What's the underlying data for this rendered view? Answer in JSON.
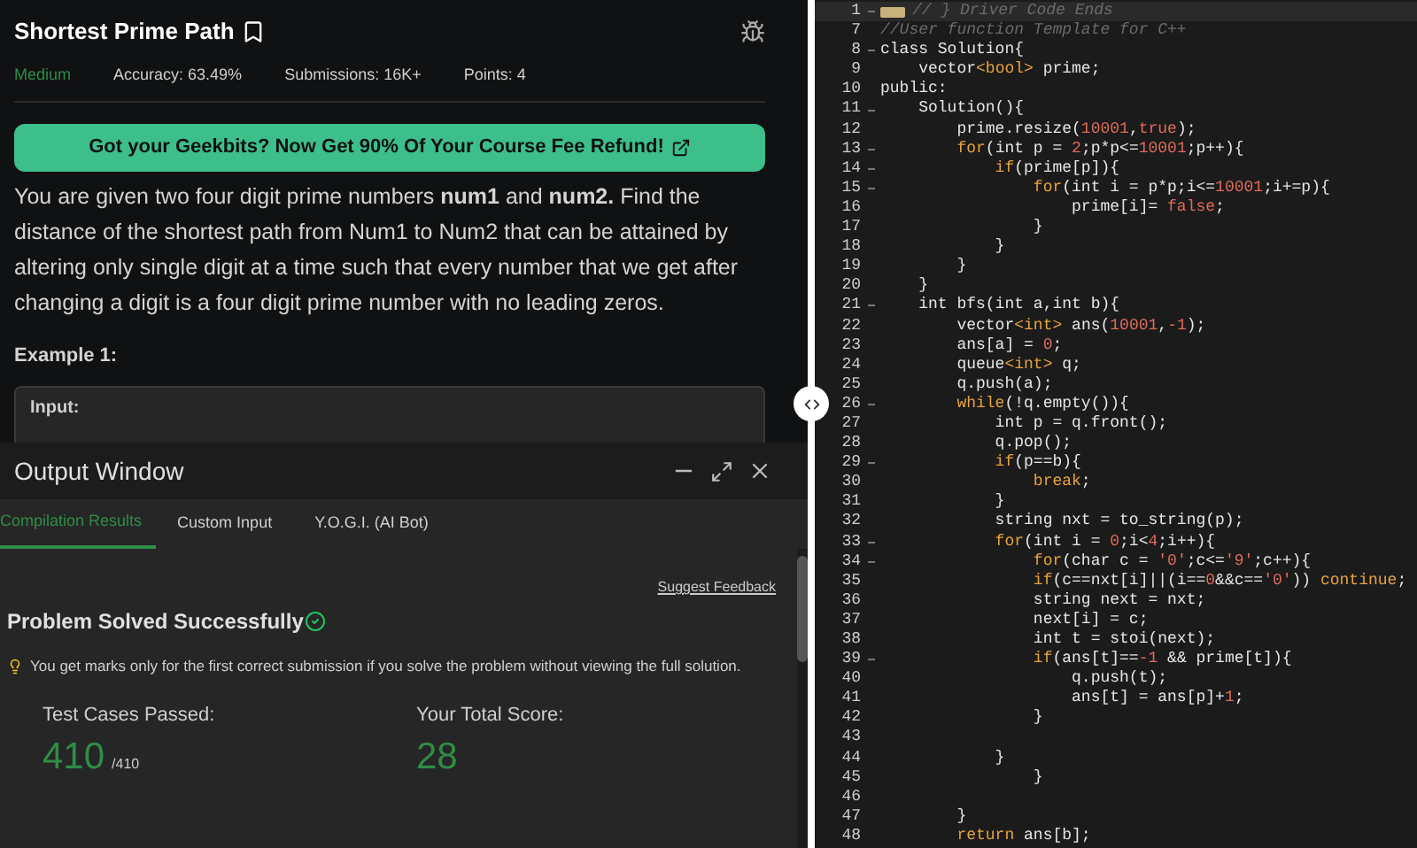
{
  "problem": {
    "title": "Shortest Prime Path",
    "difficulty": "Medium",
    "stats": [
      "Accuracy: 63.49%",
      "Submissions: 16K+",
      "Points: 4"
    ],
    "banner": "Got your Geekbits? Now Get 90% Of Your Course Fee Refund!",
    "description": "You are given two four digit prime numbers **num1** and **num2.** Find the distance of the shortest path from Num1 to Num2 that can be attained by altering only single digit at a time such that every number that we get after changing a digit is a four digit prime number with no leading zeros.",
    "example_heading": "Example 1:",
    "example_input": "Input:"
  },
  "output_window": {
    "title": "Output Window",
    "tabs": [
      {
        "label": "Compilation Results",
        "selected": true
      },
      {
        "label": "Custom Input",
        "selected": false
      },
      {
        "label": "Y.O.G.I. (AI Bot)",
        "selected": false
      }
    ],
    "feedback_link": "Suggest Feedback",
    "status": "Problem Solved Successfully",
    "note": "You get marks only for the first correct submission if you solve the problem without viewing the full solution.",
    "stats": [
      {
        "label": "Test Cases Passed:",
        "value": "410",
        "total": "/410"
      },
      {
        "label": "Your Total Score:",
        "value": "28"
      }
    ]
  },
  "editor": {
    "lines": [
      {
        "num": "1",
        "fold": true,
        "folded": true,
        "tokens": [
          {
            "kind": "comment",
            "text": "// } Driver Code Ends"
          }
        ]
      },
      {
        "num": "7",
        "fold": false,
        "folded": false,
        "tokens": [
          {
            "kind": "comment",
            "text": "//User function Template for C++"
          }
        ]
      },
      {
        "num": "8",
        "fold": true,
        "folded": false,
        "tokens": [
          {
            "kind": "plain",
            "text": "class Solution{"
          }
        ]
      },
      {
        "num": "9",
        "fold": false,
        "folded": false,
        "tokens": [
          {
            "kind": "plain",
            "text": "    vector"
          },
          {
            "kind": "type",
            "text": "<bool>"
          },
          {
            "kind": "plain",
            "text": " prime;"
          }
        ]
      },
      {
        "num": "10",
        "fold": false,
        "folded": false,
        "tokens": [
          {
            "kind": "plain",
            "text": "public:"
          }
        ]
      },
      {
        "num": "11",
        "fold": true,
        "folded": false,
        "tokens": [
          {
            "kind": "plain",
            "text": "    Solution(){"
          }
        ]
      },
      {
        "num": "12",
        "fold": false,
        "folded": false,
        "tokens": [
          {
            "kind": "plain",
            "text": "        prime.resize("
          },
          {
            "kind": "num",
            "text": "10001"
          },
          {
            "kind": "plain",
            "text": ","
          },
          {
            "kind": "num",
            "text": "true"
          },
          {
            "kind": "plain",
            "text": ");"
          }
        ]
      },
      {
        "num": "13",
        "fold": true,
        "folded": false,
        "tokens": [
          {
            "kind": "kw",
            "text": "        for"
          },
          {
            "kind": "plain",
            "text": "(int p = "
          },
          {
            "kind": "num",
            "text": "2"
          },
          {
            "kind": "plain",
            "text": ";p*p<="
          },
          {
            "kind": "num",
            "text": "10001"
          },
          {
            "kind": "plain",
            "text": ";p++){"
          }
        ]
      },
      {
        "num": "14",
        "fold": true,
        "folded": false,
        "tokens": [
          {
            "kind": "kw",
            "text": "            if"
          },
          {
            "kind": "plain",
            "text": "(prime[p]){"
          }
        ]
      },
      {
        "num": "15",
        "fold": true,
        "folded": false,
        "tokens": [
          {
            "kind": "kw",
            "text": "                for"
          },
          {
            "kind": "plain",
            "text": "(int i = p*p;i<="
          },
          {
            "kind": "num",
            "text": "10001"
          },
          {
            "kind": "plain",
            "text": ";i+=p){"
          }
        ]
      },
      {
        "num": "16",
        "fold": false,
        "folded": false,
        "tokens": [
          {
            "kind": "plain",
            "text": "                    prime[i]= "
          },
          {
            "kind": "num",
            "text": "false"
          },
          {
            "kind": "plain",
            "text": ";"
          }
        ]
      },
      {
        "num": "17",
        "fold": false,
        "folded": false,
        "tokens": [
          {
            "kind": "plain",
            "text": "                }"
          }
        ]
      },
      {
        "num": "18",
        "fold": false,
        "folded": false,
        "tokens": [
          {
            "kind": "plain",
            "text": "            }"
          }
        ]
      },
      {
        "num": "19",
        "fold": false,
        "folded": false,
        "tokens": [
          {
            "kind": "plain",
            "text": "        }"
          }
        ]
      },
      {
        "num": "20",
        "fold": false,
        "folded": false,
        "tokens": [
          {
            "kind": "plain",
            "text": "    }"
          }
        ]
      },
      {
        "num": "21",
        "fold": true,
        "folded": false,
        "tokens": [
          {
            "kind": "plain",
            "text": "    int bfs(int a,int b){"
          }
        ]
      },
      {
        "num": "22",
        "fold": false,
        "folded": false,
        "tokens": [
          {
            "kind": "plain",
            "text": "        vector"
          },
          {
            "kind": "type",
            "text": "<int>"
          },
          {
            "kind": "plain",
            "text": " ans("
          },
          {
            "kind": "num",
            "text": "10001"
          },
          {
            "kind": "plain",
            "text": ","
          },
          {
            "kind": "num",
            "text": "-1"
          },
          {
            "kind": "plain",
            "text": ");"
          }
        ]
      },
      {
        "num": "23",
        "fold": false,
        "folded": false,
        "tokens": [
          {
            "kind": "plain",
            "text": "        ans[a] = "
          },
          {
            "kind": "num",
            "text": "0"
          },
          {
            "kind": "plain",
            "text": ";"
          }
        ]
      },
      {
        "num": "24",
        "fold": false,
        "folded": false,
        "tokens": [
          {
            "kind": "plain",
            "text": "        queue"
          },
          {
            "kind": "type",
            "text": "<int>"
          },
          {
            "kind": "plain",
            "text": " q;"
          }
        ]
      },
      {
        "num": "25",
        "fold": false,
        "folded": false,
        "tokens": [
          {
            "kind": "plain",
            "text": "        q.push(a);"
          }
        ]
      },
      {
        "num": "26",
        "fold": true,
        "folded": false,
        "tokens": [
          {
            "kind": "kw",
            "text": "        while"
          },
          {
            "kind": "plain",
            "text": "(!q.empty()){"
          }
        ]
      },
      {
        "num": "27",
        "fold": false,
        "folded": false,
        "tokens": [
          {
            "kind": "plain",
            "text": "            int p = q.front();"
          }
        ]
      },
      {
        "num": "28",
        "fold": false,
        "folded": false,
        "tokens": [
          {
            "kind": "plain",
            "text": "            q.pop();"
          }
        ]
      },
      {
        "num": "29",
        "fold": true,
        "folded": false,
        "tokens": [
          {
            "kind": "kw",
            "text": "            if"
          },
          {
            "kind": "plain",
            "text": "(p==b){"
          }
        ]
      },
      {
        "num": "30",
        "fold": false,
        "folded": false,
        "tokens": [
          {
            "kind": "kw",
            "text": "                break"
          },
          {
            "kind": "plain",
            "text": ";"
          }
        ]
      },
      {
        "num": "31",
        "fold": false,
        "folded": false,
        "tokens": [
          {
            "kind": "plain",
            "text": "            }"
          }
        ]
      },
      {
        "num": "32",
        "fold": false,
        "folded": false,
        "tokens": [
          {
            "kind": "plain",
            "text": "            string nxt = to_string(p);"
          }
        ]
      },
      {
        "num": "33",
        "fold": true,
        "folded": false,
        "tokens": [
          {
            "kind": "kw",
            "text": "            for"
          },
          {
            "kind": "plain",
            "text": "(int i = "
          },
          {
            "kind": "num",
            "text": "0"
          },
          {
            "kind": "plain",
            "text": ";i<"
          },
          {
            "kind": "num",
            "text": "4"
          },
          {
            "kind": "plain",
            "text": ";i++){"
          }
        ]
      },
      {
        "num": "34",
        "fold": true,
        "folded": false,
        "tokens": [
          {
            "kind": "kw",
            "text": "                for"
          },
          {
            "kind": "plain",
            "text": "(char c = "
          },
          {
            "kind": "num",
            "text": "'0'"
          },
          {
            "kind": "plain",
            "text": ";c<="
          },
          {
            "kind": "num",
            "text": "'9'"
          },
          {
            "kind": "plain",
            "text": ";c++){"
          }
        ]
      },
      {
        "num": "35",
        "fold": false,
        "folded": false,
        "tokens": [
          {
            "kind": "kw",
            "text": "                if"
          },
          {
            "kind": "plain",
            "text": "(c==nxt[i]||(i=="
          },
          {
            "kind": "num",
            "text": "0"
          },
          {
            "kind": "plain",
            "text": "&&c=="
          },
          {
            "kind": "num",
            "text": "'0'"
          },
          {
            "kind": "plain",
            "text": ")) "
          },
          {
            "kind": "kw",
            "text": "continue"
          },
          {
            "kind": "plain",
            "text": ";"
          }
        ]
      },
      {
        "num": "36",
        "fold": false,
        "folded": false,
        "tokens": [
          {
            "kind": "plain",
            "text": "                string next = nxt;"
          }
        ]
      },
      {
        "num": "37",
        "fold": false,
        "folded": false,
        "tokens": [
          {
            "kind": "plain",
            "text": "                next[i] = c;"
          }
        ]
      },
      {
        "num": "38",
        "fold": false,
        "folded": false,
        "tokens": [
          {
            "kind": "plain",
            "text": "                int t = stoi(next);"
          }
        ]
      },
      {
        "num": "39",
        "fold": true,
        "folded": false,
        "tokens": [
          {
            "kind": "kw",
            "text": "                if"
          },
          {
            "kind": "plain",
            "text": "(ans[t]=="
          },
          {
            "kind": "num",
            "text": "-1"
          },
          {
            "kind": "plain",
            "text": " && prime[t]){"
          }
        ]
      },
      {
        "num": "40",
        "fold": false,
        "folded": false,
        "tokens": [
          {
            "kind": "plain",
            "text": "                    q.push(t);"
          }
        ]
      },
      {
        "num": "41",
        "fold": false,
        "folded": false,
        "tokens": [
          {
            "kind": "plain",
            "text": "                    ans[t] = ans[p]+"
          },
          {
            "kind": "num",
            "text": "1"
          },
          {
            "kind": "plain",
            "text": ";"
          }
        ]
      },
      {
        "num": "42",
        "fold": false,
        "folded": false,
        "tokens": [
          {
            "kind": "plain",
            "text": "                }"
          }
        ]
      },
      {
        "num": "43",
        "fold": false,
        "folded": false
      },
      {
        "num": "44",
        "fold": false,
        "folded": false,
        "tokens": [
          {
            "kind": "plain",
            "text": "            }"
          }
        ]
      },
      {
        "num": "45",
        "fold": false,
        "folded": false,
        "tokens": [
          {
            "kind": "plain",
            "text": "                }"
          }
        ]
      },
      {
        "num": "46",
        "fold": false,
        "folded": false
      },
      {
        "num": "47",
        "fold": false,
        "folded": false,
        "tokens": [
          {
            "kind": "plain",
            "text": "        }"
          }
        ]
      },
      {
        "num": "48",
        "fold": false,
        "folded": false,
        "tokens": [
          {
            "kind": "kw",
            "text": "        return"
          },
          {
            "kind": "plain",
            "text": " ans[b];"
          }
        ]
      }
    ]
  }
}
